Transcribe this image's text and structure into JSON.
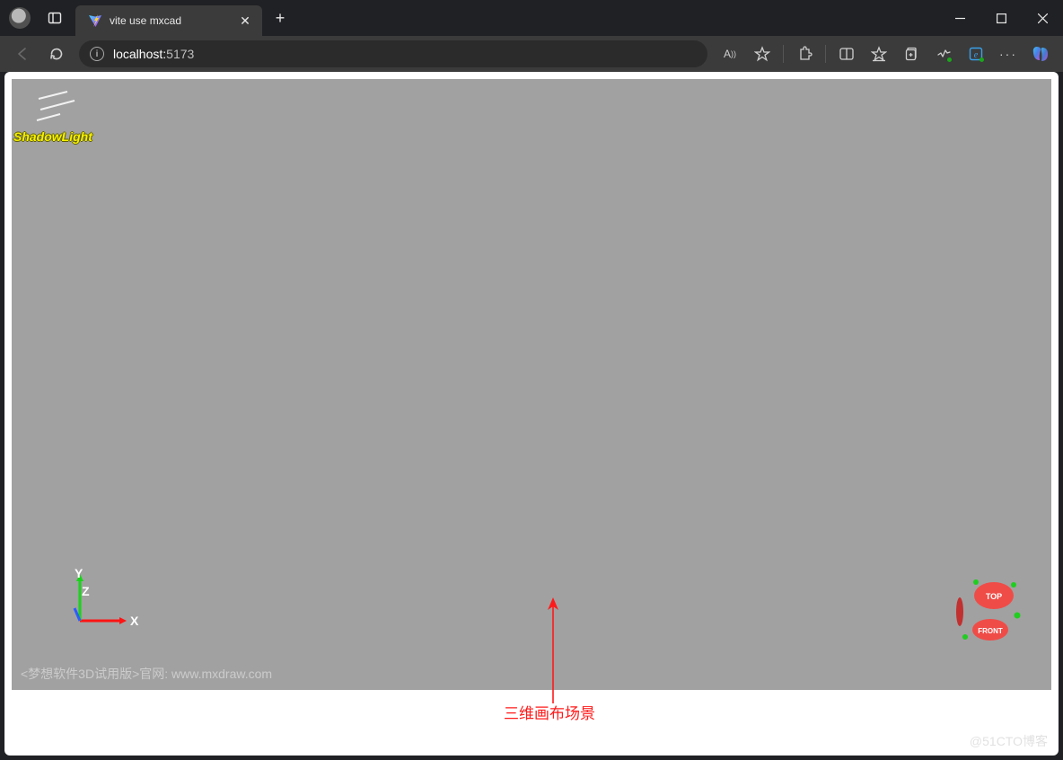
{
  "tab": {
    "title": "vite use mxcad"
  },
  "address": {
    "host": "localhost:",
    "port": "5173"
  },
  "canvas": {
    "shadowlight_label": "ShadowLight",
    "axis": {
      "x": "X",
      "y": "Y",
      "z": "Z"
    },
    "watermark": "<梦想软件3D试用版>官网: www.mxdraw.com",
    "viewcube": {
      "top": "TOP",
      "front": "FRONT"
    }
  },
  "annotation": {
    "label": "三维画布场景"
  },
  "footer": {
    "blog_watermark": "@51CTO博客"
  }
}
